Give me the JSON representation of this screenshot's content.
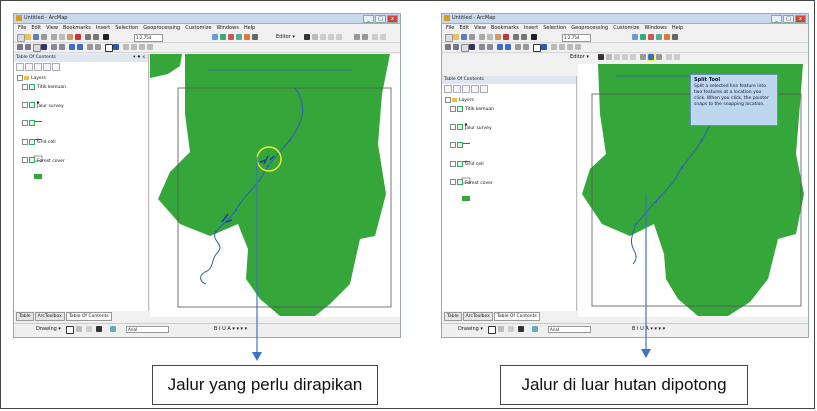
{
  "window": {
    "title": "Untitled - ArcMap",
    "menu": [
      "File",
      "Edit",
      "View",
      "Bookmarks",
      "Insert",
      "Selection",
      "Geoprocessing",
      "Customize",
      "Windows",
      "Help"
    ],
    "min": "_",
    "max": "□",
    "close": "x"
  },
  "toolbar": {
    "scale": "1:2,754",
    "editor_label": "Editor ▾"
  },
  "toc": {
    "title": "Table Of Contents",
    "pin": "▾ ♦ x",
    "layers_root": "Layers",
    "layers": [
      {
        "name": "Titik kemuan",
        "symbol": "point"
      },
      {
        "name": "Jalur survey",
        "symbol": "line"
      },
      {
        "name": "",
        "symbol": "line"
      },
      {
        "name": "",
        "symbol": "line-dot"
      },
      {
        "name": "Grid cell",
        "symbol": "box"
      },
      {
        "name": "Forest cover",
        "symbol": "fill"
      }
    ],
    "tabs": [
      "Table",
      "ArcToolbox",
      "Table Of Contents"
    ]
  },
  "drawing": {
    "label": "Drawing ▾",
    "font": "Arial",
    "icons": "B  I  U  A ▾  ▾  ▾  ▾"
  },
  "tooltip": {
    "title": "Split Tool",
    "body": "Split a selected line feature into two features at a location you click. When you click, the pointer snaps to the snapping location."
  },
  "captions": {
    "left": "Jalur yang perlu dirapikan",
    "right": "Jalur di luar hutan dipotong"
  },
  "colors": {
    "forest": "#35a63a",
    "stream": "#2f5fb8",
    "highlight": "#f2ee3c",
    "arrow": "#3f72c8"
  }
}
